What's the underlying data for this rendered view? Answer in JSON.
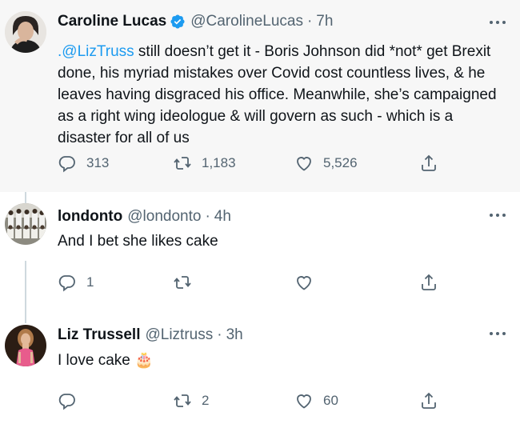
{
  "tweets": [
    {
      "name": "Caroline Lucas",
      "verified": true,
      "handle": "@CarolineLucas",
      "dot": "·",
      "time": "7h",
      "mention": ".@LizTruss",
      "text": " still doesn’t get it - Boris Johnson did *not* get Brexit done, his myriad mistakes over Covid cost countless lives, & he leaves having disgraced his office. Meanwhile, she’s campaigned as a right wing ideologue & will govern as such - which is a disaster for all of us",
      "replies": "313",
      "retweets": "1,183",
      "likes": "5,526"
    },
    {
      "name": "londonto",
      "handle": "@londonto",
      "dot": "·",
      "time": "4h",
      "text": "And I bet she likes cake",
      "replies": "1",
      "retweets": "",
      "likes": ""
    },
    {
      "name": "Liz Trussell",
      "handle": "@Liztruss",
      "dot": "·",
      "time": "3h",
      "text": "I love cake",
      "emoji": "🎂",
      "replies": "",
      "retweets": "2",
      "likes": "60"
    }
  ],
  "icons": {
    "reply": "reply-icon",
    "retweet": "retweet-icon",
    "like": "heart-icon",
    "share": "share-icon",
    "more": "more-icon",
    "verified": "verified-badge-icon"
  },
  "colors": {
    "link": "#1d9bf0",
    "muted": "#536471",
    "text": "#0f1419",
    "highlight_bg": "#f7f7f7"
  }
}
